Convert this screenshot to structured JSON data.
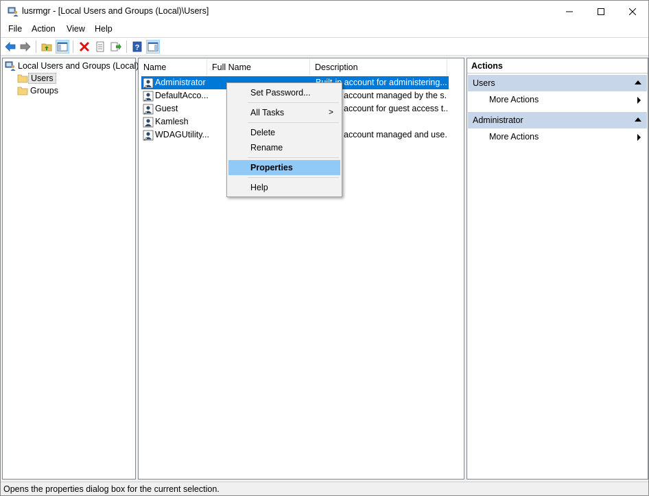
{
  "window": {
    "title": "lusrmgr - [Local Users and Groups (Local)\\Users]",
    "controls": {
      "minimize": "—",
      "maximize": "☐",
      "close": "✕"
    }
  },
  "menubar": {
    "items": [
      "File",
      "Action",
      "View",
      "Help"
    ]
  },
  "toolbar": {
    "buttons": [
      "back-icon",
      "forward-icon",
      "up-folder-icon",
      "show-hide-tree-icon",
      "delete-icon",
      "properties-icon",
      "export-list-icon",
      "help-icon",
      "show-hide-action-pane-icon"
    ]
  },
  "tree": {
    "root": "Local Users and Groups (Local)",
    "children": [
      "Users",
      "Groups"
    ],
    "selected": "Users"
  },
  "list": {
    "columns": [
      "Name",
      "Full Name",
      "Description"
    ],
    "rows": [
      {
        "name": "Administrator",
        "full_name": "",
        "description": "Built-in account for administering..."
      },
      {
        "name": "DefaultAcco...",
        "full_name": "",
        "description": "account managed by the s..."
      },
      {
        "name": "Guest",
        "full_name": "",
        "description": "account for guest access t..."
      },
      {
        "name": "Kamlesh",
        "full_name": "",
        "description": ""
      },
      {
        "name": "WDAGUtility...",
        "full_name": "",
        "description": "account managed and use..."
      }
    ],
    "selected_row": "Administrator"
  },
  "context_menu": {
    "set_password": "Set Password...",
    "all_tasks": "All Tasks",
    "delete": "Delete",
    "rename": "Rename",
    "properties": "Properties",
    "help": "Help",
    "submenu_arrow": ">"
  },
  "actions": {
    "title": "Actions",
    "sections": [
      {
        "header": "Users",
        "item": "More Actions"
      },
      {
        "header": "Administrator",
        "item": "More Actions"
      }
    ]
  },
  "statusbar": {
    "text": "Opens the properties dialog box for the current selection."
  },
  "colors": {
    "selection": "#0078d7",
    "menu_hover": "#91c9f7",
    "action_header": "#c7d6e8"
  }
}
